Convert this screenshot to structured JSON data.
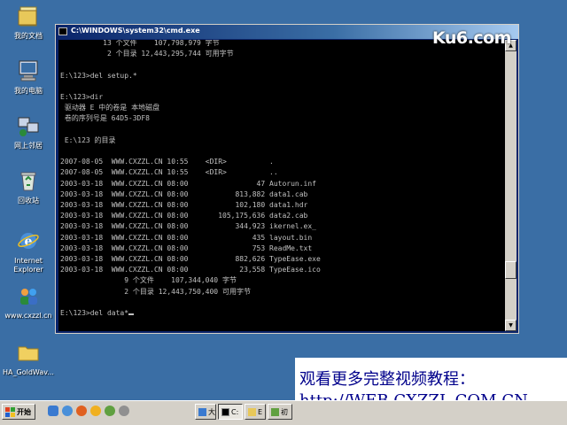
{
  "desktop": {
    "icons": [
      {
        "label": "我的文档",
        "icon": "my-documents-icon"
      },
      {
        "label": "我的电脑",
        "icon": "my-computer-icon"
      },
      {
        "label": "网上邻居",
        "icon": "network-places-icon"
      },
      {
        "label": "回收站",
        "icon": "recycle-bin-icon"
      },
      {
        "label": "Internet",
        "label2": "Explorer",
        "icon": "internet-explorer-icon"
      },
      {
        "label": "www.cxzzl.cn",
        "icon": "users-icon"
      },
      {
        "label": "HA_GoldWav...",
        "icon": "folder-icon"
      }
    ]
  },
  "cmd_window": {
    "title": "C:\\WINDOWS\\system32\\cmd.exe",
    "lines": [
      "          13 个文件    107,798,979 字节",
      "           2 个目录 12,443,295,744 可用字节",
      "",
      "E:\\123>del setup.*",
      "",
      "E:\\123>dir",
      " 驱动器 E 中的卷是 本地磁盘",
      " 卷的序列号是 64D5-3DF8",
      "",
      " E:\\123 的目录",
      "",
      "2007-08-05  WWW.CXZZL.CN 10:55    <DIR>          .",
      "2007-08-05  WWW.CXZZL.CN 10:55    <DIR>          ..",
      "2003-03-18  WWW.CXZZL.CN 08:00                47 Autorun.inf",
      "2003-03-18  WWW.CXZZL.CN 08:00           813,882 data1.cab",
      "2003-03-18  WWW.CXZZL.CN 08:00           102,180 data1.hdr",
      "2003-03-18  WWW.CXZZL.CN 08:00       105,175,636 data2.cab",
      "2003-03-18  WWW.CXZZL.CN 08:00           344,923 ikernel.ex_",
      "2003-03-18  WWW.CXZZL.CN 08:00               435 layout.bin",
      "2003-03-18  WWW.CXZZL.CN 08:00               753 ReadMe.txt",
      "2003-03-18  WWW.CXZZL.CN 08:00           882,626 TypeEase.exe",
      "2003-03-18  WWW.CXZZL.CN 08:00            23,558 TypeEase.ico",
      "               9 个文件    107,344,040 字节",
      "               2 个目录 12,443,750,400 可用字节",
      "",
      "E:\\123>del data*"
    ]
  },
  "watermark": {
    "logo_text": "Ku6.com"
  },
  "banner": {
    "line1": "观看更多完整视频教程：",
    "line2": "http://WEB.CXZZL.COM.CN"
  },
  "taskbar": {
    "start_label": "开始",
    "buttons": [
      {
        "label": "大"
      },
      {
        "label": "C:"
      },
      {
        "label": "E"
      },
      {
        "label": "初"
      }
    ]
  },
  "colors": {
    "desktop": "#3a6ea5",
    "title_bar": "#0a246a",
    "terminal_bg": "#000000",
    "terminal_fg": "#c0c0c0",
    "banner_text": "#00008b"
  }
}
